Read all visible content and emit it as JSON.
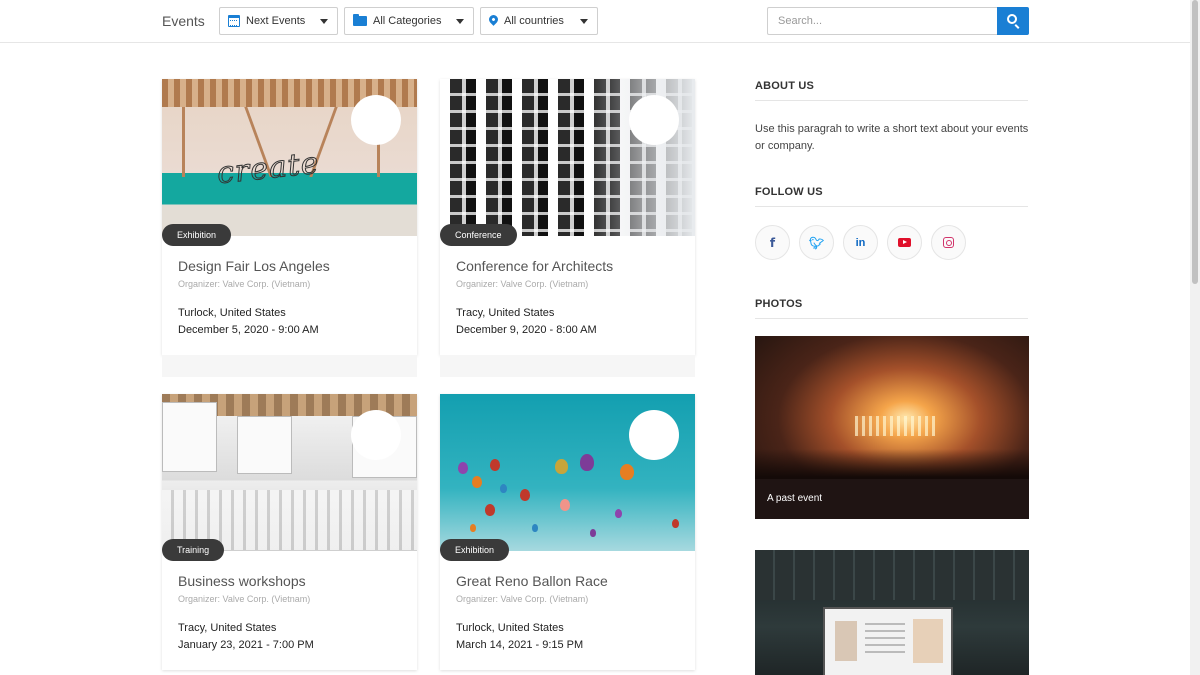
{
  "header": {
    "brand": "Events",
    "filters": [
      {
        "label": "Next Events",
        "icon": "calendar-icon"
      },
      {
        "label": "All Categories",
        "icon": "folder-icon"
      },
      {
        "label": "All countries",
        "icon": "map-pin-icon"
      }
    ],
    "search": {
      "placeholder": "Search...",
      "value": ""
    }
  },
  "colors": {
    "accent": "#1a7fd4",
    "badge": "#3a3a3a"
  },
  "events": [
    {
      "category": "Exhibition",
      "title": "Design Fair Los Angeles",
      "organizer": "Organizer: Valve Corp. (Vietnam)",
      "location": "Turlock, United States",
      "date": "December 5, 2020 - 9:00 AM"
    },
    {
      "category": "Conference",
      "title": "Conference for Architects",
      "organizer": "Organizer: Valve Corp. (Vietnam)",
      "location": "Tracy, United States",
      "date": "December 9, 2020 - 8:00 AM"
    },
    {
      "category": "Training",
      "title": "Business workshops",
      "organizer": "Organizer: Valve Corp. (Vietnam)",
      "location": "Tracy, United States",
      "date": "January 23, 2021 - 7:00 PM"
    },
    {
      "category": "Exhibition",
      "title": "Great Reno Ballon Race",
      "organizer": "Organizer: Valve Corp. (Vietnam)",
      "location": "Turlock, United States",
      "date": "March 14, 2021 - 9:15 PM"
    }
  ],
  "art": {
    "create_word": "create"
  },
  "sidebar": {
    "about_title": "ABOUT US",
    "about_text": "Use this paragrah to write a short text about your events or company.",
    "follow_title": "FOLLOW US",
    "social": [
      {
        "icon": "facebook-icon",
        "glyph": "f",
        "color": "#3b5998"
      },
      {
        "icon": "twitter-icon",
        "glyph": "t",
        "color": "#1da1f2"
      },
      {
        "icon": "linkedin-icon",
        "glyph": "in",
        "color": "#0a66c2"
      },
      {
        "icon": "youtube-icon",
        "glyph": "",
        "color": "#e0102b"
      },
      {
        "icon": "instagram-icon",
        "glyph": "",
        "color": "#d1346b"
      }
    ],
    "photos_title": "PHOTOS",
    "photo_caption": "A past event"
  }
}
